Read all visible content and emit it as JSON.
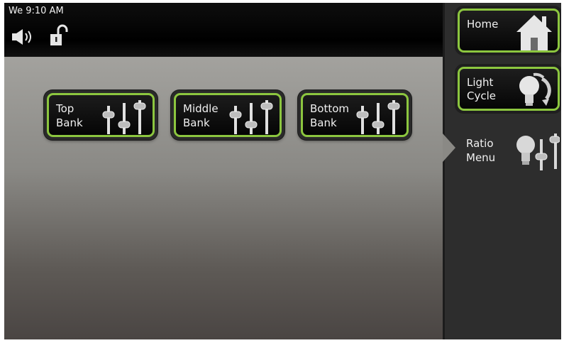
{
  "status": {
    "time": "We 9:10 AM",
    "icons": [
      "speaker-icon",
      "unlocked-padlock-icon"
    ]
  },
  "banks": [
    {
      "label": "Top\nBank",
      "icon": "sliders-icon"
    },
    {
      "label": "Middle\nBank",
      "icon": "sliders-icon"
    },
    {
      "label": "Bottom\nBank",
      "icon": "sliders-icon"
    }
  ],
  "sidebar": {
    "items": [
      {
        "label": "Home",
        "icon": "house-icon"
      },
      {
        "label": "Light\nCycle",
        "icon": "bulb-cycle-icon"
      },
      {
        "label": "Ratio\nMenu",
        "icon": "bulb-slider-icon",
        "active": true
      }
    ]
  },
  "colors": {
    "accent": "#8cc63f",
    "button_bg": "#0a0a0a",
    "sidebar_bg": "#2d2d2d",
    "status_bg": "#000000"
  }
}
